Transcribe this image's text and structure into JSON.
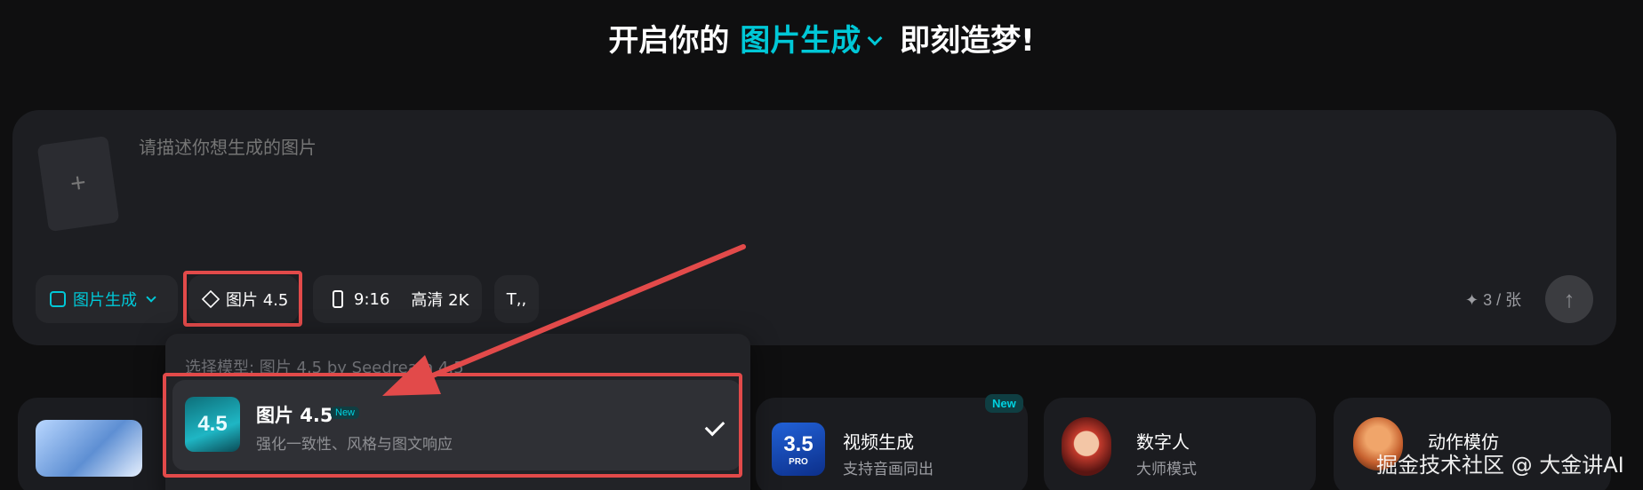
{
  "headline": {
    "prefix": "开启你的",
    "mode": "图片生成",
    "suffix": "即刻造梦!"
  },
  "composer": {
    "upload_symbol": "+",
    "prompt_placeholder": "请描述你想生成的图片"
  },
  "toolbar": {
    "mode_label": "图片生成",
    "model_label": "图片 4.5",
    "ratio_label": "9:16",
    "quality_label": "高清 2K",
    "text_tool_symbol": "T,,",
    "quota_label": "✦ 3 / 张",
    "send_symbol": "↑"
  },
  "dropdown": {
    "caption": "选择模型: 图片 4.5 by Seedream 4.5",
    "selected_item": {
      "icon_text": "4.5",
      "title": "图片 4.5",
      "badge": "New",
      "description": "强化一致性、风格与图文响应"
    }
  },
  "feature_cards": [
    {
      "title": "视频生成",
      "subtitle": "支持音画同出",
      "badge": "New",
      "icon_text": "3.5",
      "icon_subtext": "PRO"
    },
    {
      "title": "数字人",
      "subtitle": "大师模式"
    },
    {
      "title": "动作模仿",
      "subtitle": ""
    }
  ],
  "watermark": "掘金技术社区 @ 大金讲AI",
  "colors": {
    "accent": "#00c8d7",
    "highlight": "#e24a4a",
    "background": "#0f0f10",
    "panel": "#1d1e22"
  }
}
